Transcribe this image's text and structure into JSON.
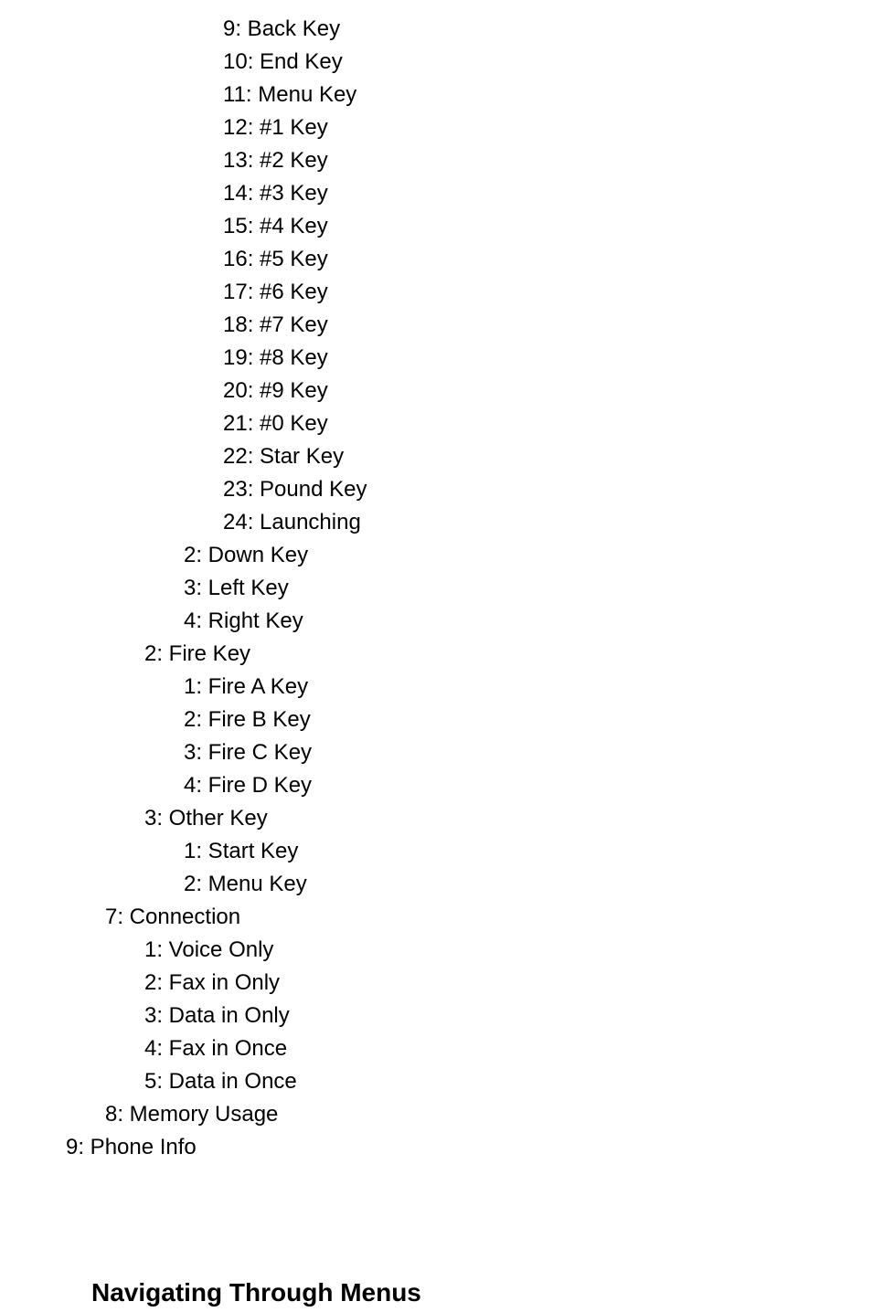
{
  "lines": [
    {
      "indent": 4,
      "text": "9: Back Key"
    },
    {
      "indent": 4,
      "text": "10: End Key"
    },
    {
      "indent": 4,
      "text": "11: Menu Key"
    },
    {
      "indent": 4,
      "text": "12: #1 Key"
    },
    {
      "indent": 4,
      "text": "13: #2 Key"
    },
    {
      "indent": 4,
      "text": "14: #3 Key"
    },
    {
      "indent": 4,
      "text": "15: #4 Key"
    },
    {
      "indent": 4,
      "text": "16: #5 Key"
    },
    {
      "indent": 4,
      "text": "17: #6 Key"
    },
    {
      "indent": 4,
      "text": "18: #7 Key"
    },
    {
      "indent": 4,
      "text": "19: #8 Key"
    },
    {
      "indent": 4,
      "text": "20: #9 Key"
    },
    {
      "indent": 4,
      "text": "21: #0 Key"
    },
    {
      "indent": 4,
      "text": "22: Star Key"
    },
    {
      "indent": 4,
      "text": "23: Pound Key"
    },
    {
      "indent": 4,
      "text": "24: Launching"
    },
    {
      "indent": 3,
      "text": "2: Down Key"
    },
    {
      "indent": 3,
      "text": "3: Left Key"
    },
    {
      "indent": 3,
      "text": "4: Right Key"
    },
    {
      "indent": 2,
      "text": "2: Fire Key"
    },
    {
      "indent": 3,
      "text": "1: Fire A Key"
    },
    {
      "indent": 3,
      "text": "2: Fire B Key"
    },
    {
      "indent": 3,
      "text": "3: Fire C Key"
    },
    {
      "indent": 3,
      "text": "4: Fire D Key"
    },
    {
      "indent": 2,
      "text": "3: Other Key"
    },
    {
      "indent": 3,
      "text": "1: Start Key"
    },
    {
      "indent": 3,
      "text": "2: Menu Key"
    },
    {
      "indent": 1,
      "text": "7: Connection"
    },
    {
      "indent": 2,
      "text": "1: Voice Only"
    },
    {
      "indent": 2,
      "text": "2: Fax in Only"
    },
    {
      "indent": 2,
      "text": "3: Data in Only"
    },
    {
      "indent": 2,
      "text": "4: Fax in Once"
    },
    {
      "indent": 2,
      "text": "5: Data in Once"
    },
    {
      "indent": 1,
      "text": "8: Memory Usage"
    },
    {
      "indent": 0,
      "text": "9: Phone Info"
    }
  ],
  "section_heading": "Navigating Through Menus"
}
